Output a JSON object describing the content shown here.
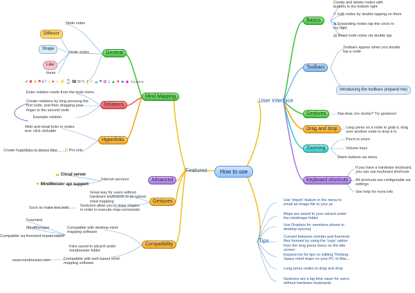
{
  "root": {
    "label": "How to use"
  },
  "features": {
    "label": "Features"
  },
  "user_interface": {
    "label": "User interface"
  },
  "tips": {
    "label": "Tips"
  },
  "mind_mapping": {
    "label": "Mind Mapping"
  },
  "general": {
    "label": "General",
    "node_notes": "Node notes",
    "node_styles": "Node styles",
    "styles": [
      "Different",
      "Shape",
      "Like",
      "these"
    ],
    "icons_label": "Icons"
  },
  "relations": {
    "label": "Relations",
    "enter_relation": "Enter relation mode from the tools menu",
    "create_relation": "Create relations by long-pressing the first node, and then dragging your finger to the second node",
    "example_relation": "Example relation"
  },
  "hyperlinks": {
    "label": "Hyperlinks",
    "web_email": "Web and email links in nodes text: click clickable",
    "create_links": "Create hyperlinks to device files",
    "pro_only": "Pro only"
  },
  "advanced": {
    "label": "Advanced",
    "internet_services": "Internet services",
    "cloud_server": "Cloud server",
    "mindmeister": "MindMeister api support"
  },
  "gestures_feat": {
    "label": "Gestures",
    "great_way": "Great way for users without hardware keyboards to do typical mind mapping",
    "gestures_allow": "Gestures allow you to draw shapes in order to execute map commands",
    "such_as": "Such as make text bold"
  },
  "compatibility": {
    "label": "Compatibility",
    "freemind": "Freemind",
    "mindmanager": "MindManager",
    "freemind_export": "Compatible via freemind import export",
    "compatible_desktop": "Compatible with desktop mind mapping software",
    "files_saved": "Files saved to sdcard under mindmeister folder",
    "compat_web": "Compatible with web based mind mapping software",
    "mindmeister_url": "www.mindmeister.com"
  },
  "basics": {
    "label": "Basics",
    "create_delete": "Create and delete nodes with buttons in the bottom right",
    "edit_nodes": "Edit nodes by double tapping on them",
    "expanding": "Expanding nodes tap the circle to my right",
    "read_notes": "Read node notes via double tap"
  },
  "toolbars": {
    "label": "Toolbars",
    "appear": "Toolbars appear when you double tap a node",
    "introducing": "Introducing the toolbars (expand me)"
  },
  "gestures_ui": {
    "label": "Gestures",
    "too_slow": "Too slow, too clunky? Try gestures!"
  },
  "drag_drop": {
    "label": "Drag and drop",
    "long_press": "Long press on a node to grab it, drag over another node to drop it in"
  },
  "zooming": {
    "label": "Zooming",
    "pinch": "Pinch to zoom",
    "volume": "Volume keys",
    "zoom_buttons": "Zoom buttons via menu"
  },
  "keyboard": {
    "label": "Keyboard shortcuts",
    "hardware": "If you have a hardware keyboard, you can use keyboard shortcuts",
    "all_shortcuts": "All shortcuts are configurable via settings",
    "see_help": "See help for more info"
  },
  "tips_items": [
    "Use 'import' feature in the menu to email an image file to your pc",
    "Maps are saved to your sdcard under the mindmaps folder",
    "Use Dropbox for seemless phone to desktop syncing",
    "Convert between ovmdet and freemind files formats by using the 'copy' option from the long press menu on the title screen",
    "Expand me for tips on editing Thinking Space mind maps on your PC or Mac...",
    "Long press nodes to drag and drop",
    "Gestures are a big time saver for users without hardware keyboards"
  ],
  "colors": {
    "green": "#3bc43b",
    "red": "#f05259",
    "orange": "#f1a51c",
    "purple": "#a979e8",
    "teal": "#2ccbc7",
    "blue": "#7fb8f1",
    "line_yellow": "#f0c020",
    "line_blue": "#6fa3d8"
  }
}
